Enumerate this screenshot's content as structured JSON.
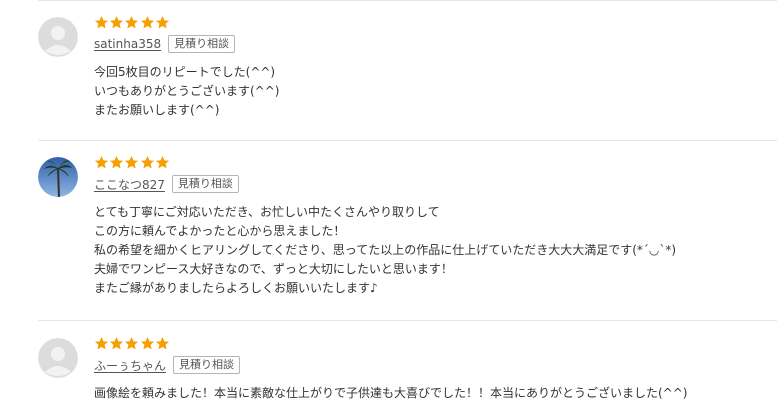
{
  "colors": {
    "star": "#f5a000",
    "avatar_bg": "#dcdcdc",
    "avatar_fg": "#f2f2f2"
  },
  "reviews": [
    {
      "rating": 5,
      "avatar": "default-avatar",
      "username": "satinha358",
      "estimate_label": "見積り相談",
      "lines": [
        "今回5枚目のリピートでした(^^)",
        "いつもありがとうございます(^^)",
        "またお願いします(^^)"
      ]
    },
    {
      "rating": 5,
      "avatar": "palm-tree-photo",
      "username": "ここなつ827",
      "estimate_label": "見積り相談",
      "lines": [
        "とても丁寧にご対応いただき、お忙しい中たくさんやり取りして",
        "この方に頼んでよかったと心から思えました！",
        "私の希望を細かくヒアリングしてくださり、思ってた以上の作品に仕上げていただき大大大満足です(*´◡`*)",
        "夫婦でワンピース大好きなので、ずっと大切にしたいと思います！",
        "またご縁がありましたらよろしくお願いいたします♪"
      ]
    },
    {
      "rating": 5,
      "avatar": "default-avatar",
      "username": "ふーぅちゃん",
      "estimate_label": "見積り相談",
      "lines": [
        "画像絵を頼みました！本当に素敵な仕上がりで子供達も大喜びでした！！本当にありがとうございました(^^)"
      ]
    }
  ]
}
